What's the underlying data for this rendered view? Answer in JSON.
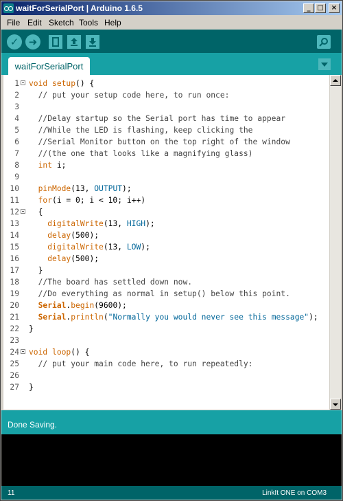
{
  "window": {
    "title": "waitForSerialPort | Arduino 1.6.5"
  },
  "title_buttons": {
    "minimize": "_",
    "maximize": "□",
    "close": "×"
  },
  "menu": [
    "File",
    "Edit",
    "Sketch",
    "Tools",
    "Help"
  ],
  "toolbar": {
    "verify_icon": "check-icon",
    "upload_icon": "arrow-right-icon",
    "new_icon": "new-file-icon",
    "open_icon": "open-arrow-up-icon",
    "save_icon": "save-arrow-down-icon",
    "serial_icon": "magnifier-icon"
  },
  "tab": {
    "label": "waitForSerialPort"
  },
  "code": {
    "lines": [
      "void setup() {",
      "  // put your setup code here, to run once:",
      "",
      "  //Delay startup so the Serial port has time to appear",
      "  //While the LED is flashing, keep clicking the",
      "  //Serial Monitor button on the top right of the window",
      "  //(the one that looks like a magnifying glass)",
      "  int i;",
      "",
      "  pinMode(13, OUTPUT);",
      "  for(i = 0; i < 10; i++)",
      "  {",
      "    digitalWrite(13, HIGH);",
      "    delay(500);",
      "    digitalWrite(13, LOW);",
      "    delay(500);",
      "  }",
      "  //The board has settled down now.",
      "  //Do everything as normal in setup() below this point.",
      "  Serial.begin(9600);",
      "  Serial.println(\"Normally you would never see this message\");",
      "}",
      "",
      "void loop() {",
      "  // put your main code here, to run repeatedly:",
      "",
      "}"
    ],
    "fold_lines": [
      1,
      12,
      24
    ]
  },
  "status": {
    "message": "Done Saving."
  },
  "footer": {
    "line_number": "11",
    "board": "LinkIt ONE on COM3"
  }
}
